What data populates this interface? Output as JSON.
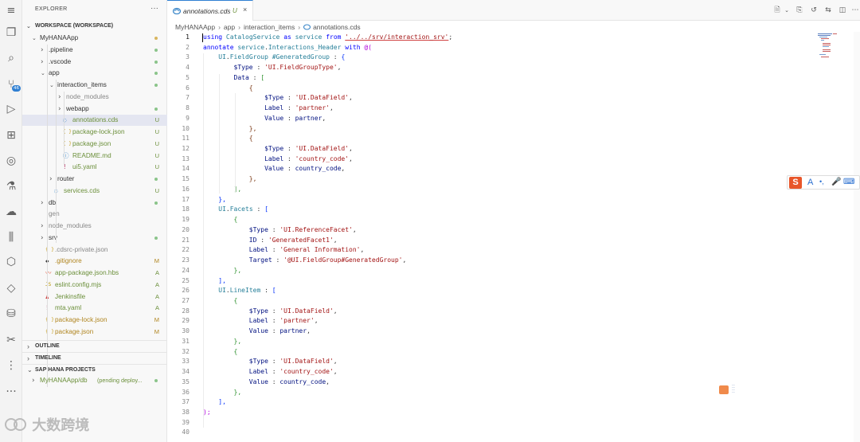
{
  "colors": {
    "accent": "#2f7fd2",
    "untracked": "#6b8f3a",
    "modified": "#b0851f",
    "added": "#6b8f3a",
    "dot_green": "#8bc48a",
    "dot_yellow": "#d8b55e"
  },
  "explorer": {
    "title": "EXPLORER",
    "more": "···",
    "workspace": "WORKSPACE (WORKSPACE)",
    "tree": [
      {
        "label": "MyHANAApp",
        "depth": 1,
        "type": "folder-open",
        "status": "dot-yellow"
      },
      {
        "label": ".pipeline",
        "depth": 2,
        "type": "folder",
        "status": "dot-green"
      },
      {
        "label": ".vscode",
        "depth": 2,
        "type": "folder",
        "status": "dot-green"
      },
      {
        "label": "app",
        "depth": 2,
        "type": "folder-open",
        "status": "dot-green"
      },
      {
        "label": "interaction_items",
        "depth": 3,
        "type": "folder-open",
        "status": "dot-green"
      },
      {
        "label": "node_modules",
        "depth": 4,
        "type": "folder",
        "status": "",
        "dim": true
      },
      {
        "label": "webapp",
        "depth": 4,
        "type": "folder",
        "status": "dot-green"
      },
      {
        "label": "annotations.cds",
        "depth": 4,
        "type": "cds",
        "status": "U",
        "selected": true
      },
      {
        "label": "package-lock.json",
        "depth": 4,
        "type": "json",
        "status": "U"
      },
      {
        "label": "package.json",
        "depth": 4,
        "type": "json",
        "status": "U"
      },
      {
        "label": "README.md",
        "depth": 4,
        "type": "md",
        "status": "U"
      },
      {
        "label": "ui5.yaml",
        "depth": 4,
        "type": "yaml",
        "status": "U"
      },
      {
        "label": "router",
        "depth": 3,
        "type": "folder",
        "status": "dot-green"
      },
      {
        "label": "services.cds",
        "depth": 3,
        "type": "cds",
        "status": "U"
      },
      {
        "label": "db",
        "depth": 2,
        "type": "folder",
        "status": "dot-green"
      },
      {
        "label": "gen",
        "depth": 2,
        "type": "folder-noarrow",
        "status": "",
        "dim": true
      },
      {
        "label": "node_modules",
        "depth": 2,
        "type": "folder",
        "status": "",
        "dim": true
      },
      {
        "label": "srv",
        "depth": 2,
        "type": "folder",
        "status": "dot-green"
      },
      {
        "label": ".cdsrc-private.json",
        "depth": 2,
        "type": "json",
        "status": "",
        "dim": true
      },
      {
        "label": ".gitignore",
        "depth": 2,
        "type": "git",
        "status": "M"
      },
      {
        "label": "app-package.json.hbs",
        "depth": 2,
        "type": "hbs",
        "status": "A"
      },
      {
        "label": "eslint.config.mjs",
        "depth": 2,
        "type": "js",
        "status": "A"
      },
      {
        "label": "Jenkinsfile",
        "depth": 2,
        "type": "jenkins",
        "status": "A"
      },
      {
        "label": "mta.yaml",
        "depth": 2,
        "type": "yaml",
        "status": "A"
      },
      {
        "label": "package-lock.json",
        "depth": 2,
        "type": "json",
        "status": "M"
      },
      {
        "label": "package.json",
        "depth": 2,
        "type": "json",
        "status": "M"
      }
    ],
    "sections": [
      {
        "label": "OUTLINE"
      },
      {
        "label": "TIMELINE"
      },
      {
        "label": "SAP HANA PROJECTS"
      }
    ],
    "hana_item": "MyHANAApp/db",
    "hana_item_note": "(pending deploy..."
  },
  "activity": {
    "icons": [
      "menu-icon",
      "files-icon",
      "search-icon",
      "source-control-icon",
      "run-debug-icon",
      "extensions-icon",
      "remote-explorer-icon",
      "testing-icon",
      "cloud-icon",
      "library-icon",
      "cube-icon",
      "diamond-icon",
      "database-icon",
      "tools-icon",
      "git-graph-icon",
      "more-icon"
    ],
    "scm_badge": "46",
    "more": "···"
  },
  "tab": {
    "label": "annotations.cds",
    "status": "U",
    "close": "×"
  },
  "breadcrumb": {
    "items": [
      "MyHANAApp",
      "app",
      "interaction_items",
      "annotations.cds"
    ]
  },
  "code": {
    "lines": [
      [
        [
          "kw",
          "using"
        ],
        [
          "pu",
          " "
        ],
        [
          "ty",
          "CatalogService"
        ],
        [
          "pu",
          " "
        ],
        [
          "kw",
          "as"
        ],
        [
          "pu",
          " "
        ],
        [
          "ty",
          "service"
        ],
        [
          "pu",
          " "
        ],
        [
          "kw",
          "from"
        ],
        [
          "pu",
          " "
        ],
        [
          "st",
          "'../../srv/interaction_srv'"
        ],
        [
          "pu",
          ";"
        ]
      ],
      [
        [
          "kw",
          "annotate"
        ],
        [
          "pu",
          " "
        ],
        [
          "ty",
          "service"
        ],
        [
          "pu",
          "."
        ],
        [
          "ty",
          "Interactions_Header"
        ],
        [
          "pu",
          " "
        ],
        [
          "kw",
          "with"
        ],
        [
          "pu",
          " "
        ],
        [
          "br0",
          "@("
        ]
      ],
      [
        [
          "pu",
          "    "
        ],
        [
          "ty",
          "UI"
        ],
        [
          "pu",
          "."
        ],
        [
          "ty",
          "FieldGroup"
        ],
        [
          "pu",
          " "
        ],
        [
          "ty",
          "#GeneratedGroup"
        ],
        [
          "pu",
          " : "
        ],
        [
          "br1",
          "{"
        ]
      ],
      [
        [
          "pu",
          "        "
        ],
        [
          "pr",
          "$Type"
        ],
        [
          "pu",
          " : "
        ],
        [
          "st",
          "'UI.FieldGroupType'"
        ],
        [
          "pu",
          ","
        ]
      ],
      [
        [
          "pu",
          "        "
        ],
        [
          "pr",
          "Data"
        ],
        [
          "pu",
          " : "
        ],
        [
          "br2",
          "["
        ]
      ],
      [
        [
          "pu",
          "            "
        ],
        [
          "br3",
          "{"
        ]
      ],
      [
        [
          "pu",
          "                "
        ],
        [
          "pr",
          "$Type"
        ],
        [
          "pu",
          " : "
        ],
        [
          "st",
          "'UI.DataField'"
        ],
        [
          "pu",
          ","
        ]
      ],
      [
        [
          "pu",
          "                "
        ],
        [
          "pr",
          "Label"
        ],
        [
          "pu",
          " : "
        ],
        [
          "st",
          "'partner'"
        ],
        [
          "pu",
          ","
        ]
      ],
      [
        [
          "pu",
          "                "
        ],
        [
          "pr",
          "Value"
        ],
        [
          "pu",
          " : "
        ],
        [
          "pr",
          "partner"
        ],
        [
          "pu",
          ","
        ]
      ],
      [
        [
          "pu",
          "            "
        ],
        [
          "br3",
          "},"
        ]
      ],
      [
        [
          "pu",
          "            "
        ],
        [
          "br3",
          "{"
        ]
      ],
      [
        [
          "pu",
          "                "
        ],
        [
          "pr",
          "$Type"
        ],
        [
          "pu",
          " : "
        ],
        [
          "st",
          "'UI.DataField'"
        ],
        [
          "pu",
          ","
        ]
      ],
      [
        [
          "pu",
          "                "
        ],
        [
          "pr",
          "Label"
        ],
        [
          "pu",
          " : "
        ],
        [
          "st",
          "'country_code'"
        ],
        [
          "pu",
          ","
        ]
      ],
      [
        [
          "pu",
          "                "
        ],
        [
          "pr",
          "Value"
        ],
        [
          "pu",
          " : "
        ],
        [
          "pr",
          "country_code"
        ],
        [
          "pu",
          ","
        ]
      ],
      [
        [
          "pu",
          "            "
        ],
        [
          "br3",
          "},"
        ]
      ],
      [
        [
          "pu",
          "        "
        ],
        [
          "br2",
          "],"
        ]
      ],
      [
        [
          "pu",
          "    "
        ],
        [
          "br1",
          "},"
        ]
      ],
      [
        [
          "pu",
          "    "
        ],
        [
          "ty",
          "UI"
        ],
        [
          "pu",
          "."
        ],
        [
          "ty",
          "Facets"
        ],
        [
          "pu",
          " : "
        ],
        [
          "br1",
          "["
        ]
      ],
      [
        [
          "pu",
          "        "
        ],
        [
          "br2",
          "{"
        ]
      ],
      [
        [
          "pu",
          "            "
        ],
        [
          "pr",
          "$Type"
        ],
        [
          "pu",
          " : "
        ],
        [
          "st",
          "'UI.ReferenceFacet'"
        ],
        [
          "pu",
          ","
        ]
      ],
      [
        [
          "pu",
          "            "
        ],
        [
          "pr",
          "ID"
        ],
        [
          "pu",
          " : "
        ],
        [
          "st",
          "'GeneratedFacet1'"
        ],
        [
          "pu",
          ","
        ]
      ],
      [
        [
          "pu",
          "            "
        ],
        [
          "pr",
          "Label"
        ],
        [
          "pu",
          " : "
        ],
        [
          "st",
          "'General Information'"
        ],
        [
          "pu",
          ","
        ]
      ],
      [
        [
          "pu",
          "            "
        ],
        [
          "pr",
          "Target"
        ],
        [
          "pu",
          " : "
        ],
        [
          "st",
          "'@UI.FieldGroup#GeneratedGroup'"
        ],
        [
          "pu",
          ","
        ]
      ],
      [
        [
          "pu",
          "        "
        ],
        [
          "br2",
          "},"
        ]
      ],
      [
        [
          "pu",
          "    "
        ],
        [
          "br1",
          "],"
        ]
      ],
      [
        [
          "pu",
          "    "
        ],
        [
          "ty",
          "UI"
        ],
        [
          "pu",
          "."
        ],
        [
          "ty",
          "LineItem"
        ],
        [
          "pu",
          " : "
        ],
        [
          "br1",
          "["
        ]
      ],
      [
        [
          "pu",
          "        "
        ],
        [
          "br2",
          "{"
        ]
      ],
      [
        [
          "pu",
          "            "
        ],
        [
          "pr",
          "$Type"
        ],
        [
          "pu",
          " : "
        ],
        [
          "st",
          "'UI.DataField'"
        ],
        [
          "pu",
          ","
        ]
      ],
      [
        [
          "pu",
          "            "
        ],
        [
          "pr",
          "Label"
        ],
        [
          "pu",
          " : "
        ],
        [
          "st",
          "'partner'"
        ],
        [
          "pu",
          ","
        ]
      ],
      [
        [
          "pu",
          "            "
        ],
        [
          "pr",
          "Value"
        ],
        [
          "pu",
          " : "
        ],
        [
          "pr",
          "partner"
        ],
        [
          "pu",
          ","
        ]
      ],
      [
        [
          "pu",
          "        "
        ],
        [
          "br2",
          "},"
        ]
      ],
      [
        [
          "pu",
          "        "
        ],
        [
          "br2",
          "{"
        ]
      ],
      [
        [
          "pu",
          "            "
        ],
        [
          "pr",
          "$Type"
        ],
        [
          "pu",
          " : "
        ],
        [
          "st",
          "'UI.DataField'"
        ],
        [
          "pu",
          ","
        ]
      ],
      [
        [
          "pu",
          "            "
        ],
        [
          "pr",
          "Label"
        ],
        [
          "pu",
          " : "
        ],
        [
          "st",
          "'country_code'"
        ],
        [
          "pu",
          ","
        ]
      ],
      [
        [
          "pu",
          "            "
        ],
        [
          "pr",
          "Value"
        ],
        [
          "pu",
          " : "
        ],
        [
          "pr",
          "country_code"
        ],
        [
          "pu",
          ","
        ]
      ],
      [
        [
          "pu",
          "        "
        ],
        [
          "br2",
          "},"
        ]
      ],
      [
        [
          "pu",
          "    "
        ],
        [
          "br1",
          "],"
        ]
      ],
      [
        [
          "br0",
          ");"
        ]
      ],
      [],
      []
    ]
  },
  "watermark": "大数跨境"
}
